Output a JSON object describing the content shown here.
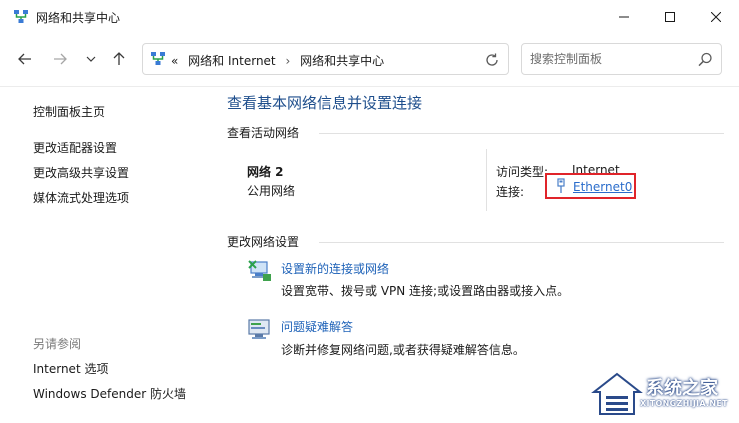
{
  "window": {
    "title": "网络和共享中心",
    "app_icon": "network-center-icon"
  },
  "titlebar_buttons": {
    "minimize_icon": "minimize-icon",
    "maximize_icon": "maximize-icon",
    "close_icon": "close-icon"
  },
  "nav": {
    "back_icon": "arrow-left-icon",
    "forward_icon": "arrow-right-icon",
    "recent_icon": "chevron-down-icon",
    "up_icon": "arrow-up-icon"
  },
  "address": {
    "overflow": "«",
    "crumb1": "网络和 Internet",
    "sep": "›",
    "crumb2": "网络和共享中心",
    "refresh_icon": "refresh-icon"
  },
  "search": {
    "placeholder": "搜索控制面板",
    "icon": "search-icon"
  },
  "sidebar": {
    "home": "控制面板主页",
    "links": [
      "更改适配器设置",
      "更改高级共享设置",
      "媒体流式处理选项"
    ],
    "see_also_title": "另请参阅",
    "see_also": [
      "Internet 选项",
      "Windows Defender 防火墙"
    ]
  },
  "main": {
    "heading": "查看基本网络信息并设置连接",
    "active_section": "查看活动网络",
    "network": {
      "name": "网络 2",
      "type": "公用网络",
      "access_label": "访问类型:",
      "access_value": "Internet",
      "conn_label": "连接:",
      "conn_value": "Ethernet0"
    },
    "change_section": "更改网络设置",
    "tasks": [
      {
        "icon": "new-connection-icon",
        "link": "设置新的连接或网络",
        "desc": "设置宽带、拨号或 VPN 连接;或设置路由器或接入点。"
      },
      {
        "icon": "troubleshoot-icon",
        "link": "问题疑难解答",
        "desc": "诊断并修复网络问题,或者获得疑难解答信息。"
      }
    ]
  },
  "watermark": {
    "brand": "系统之家",
    "url": "XITONGZHIJIA.NET"
  },
  "colors": {
    "heading": "#1e4e8c",
    "link": "#1e62b8",
    "highlight_border": "#e0242a"
  }
}
